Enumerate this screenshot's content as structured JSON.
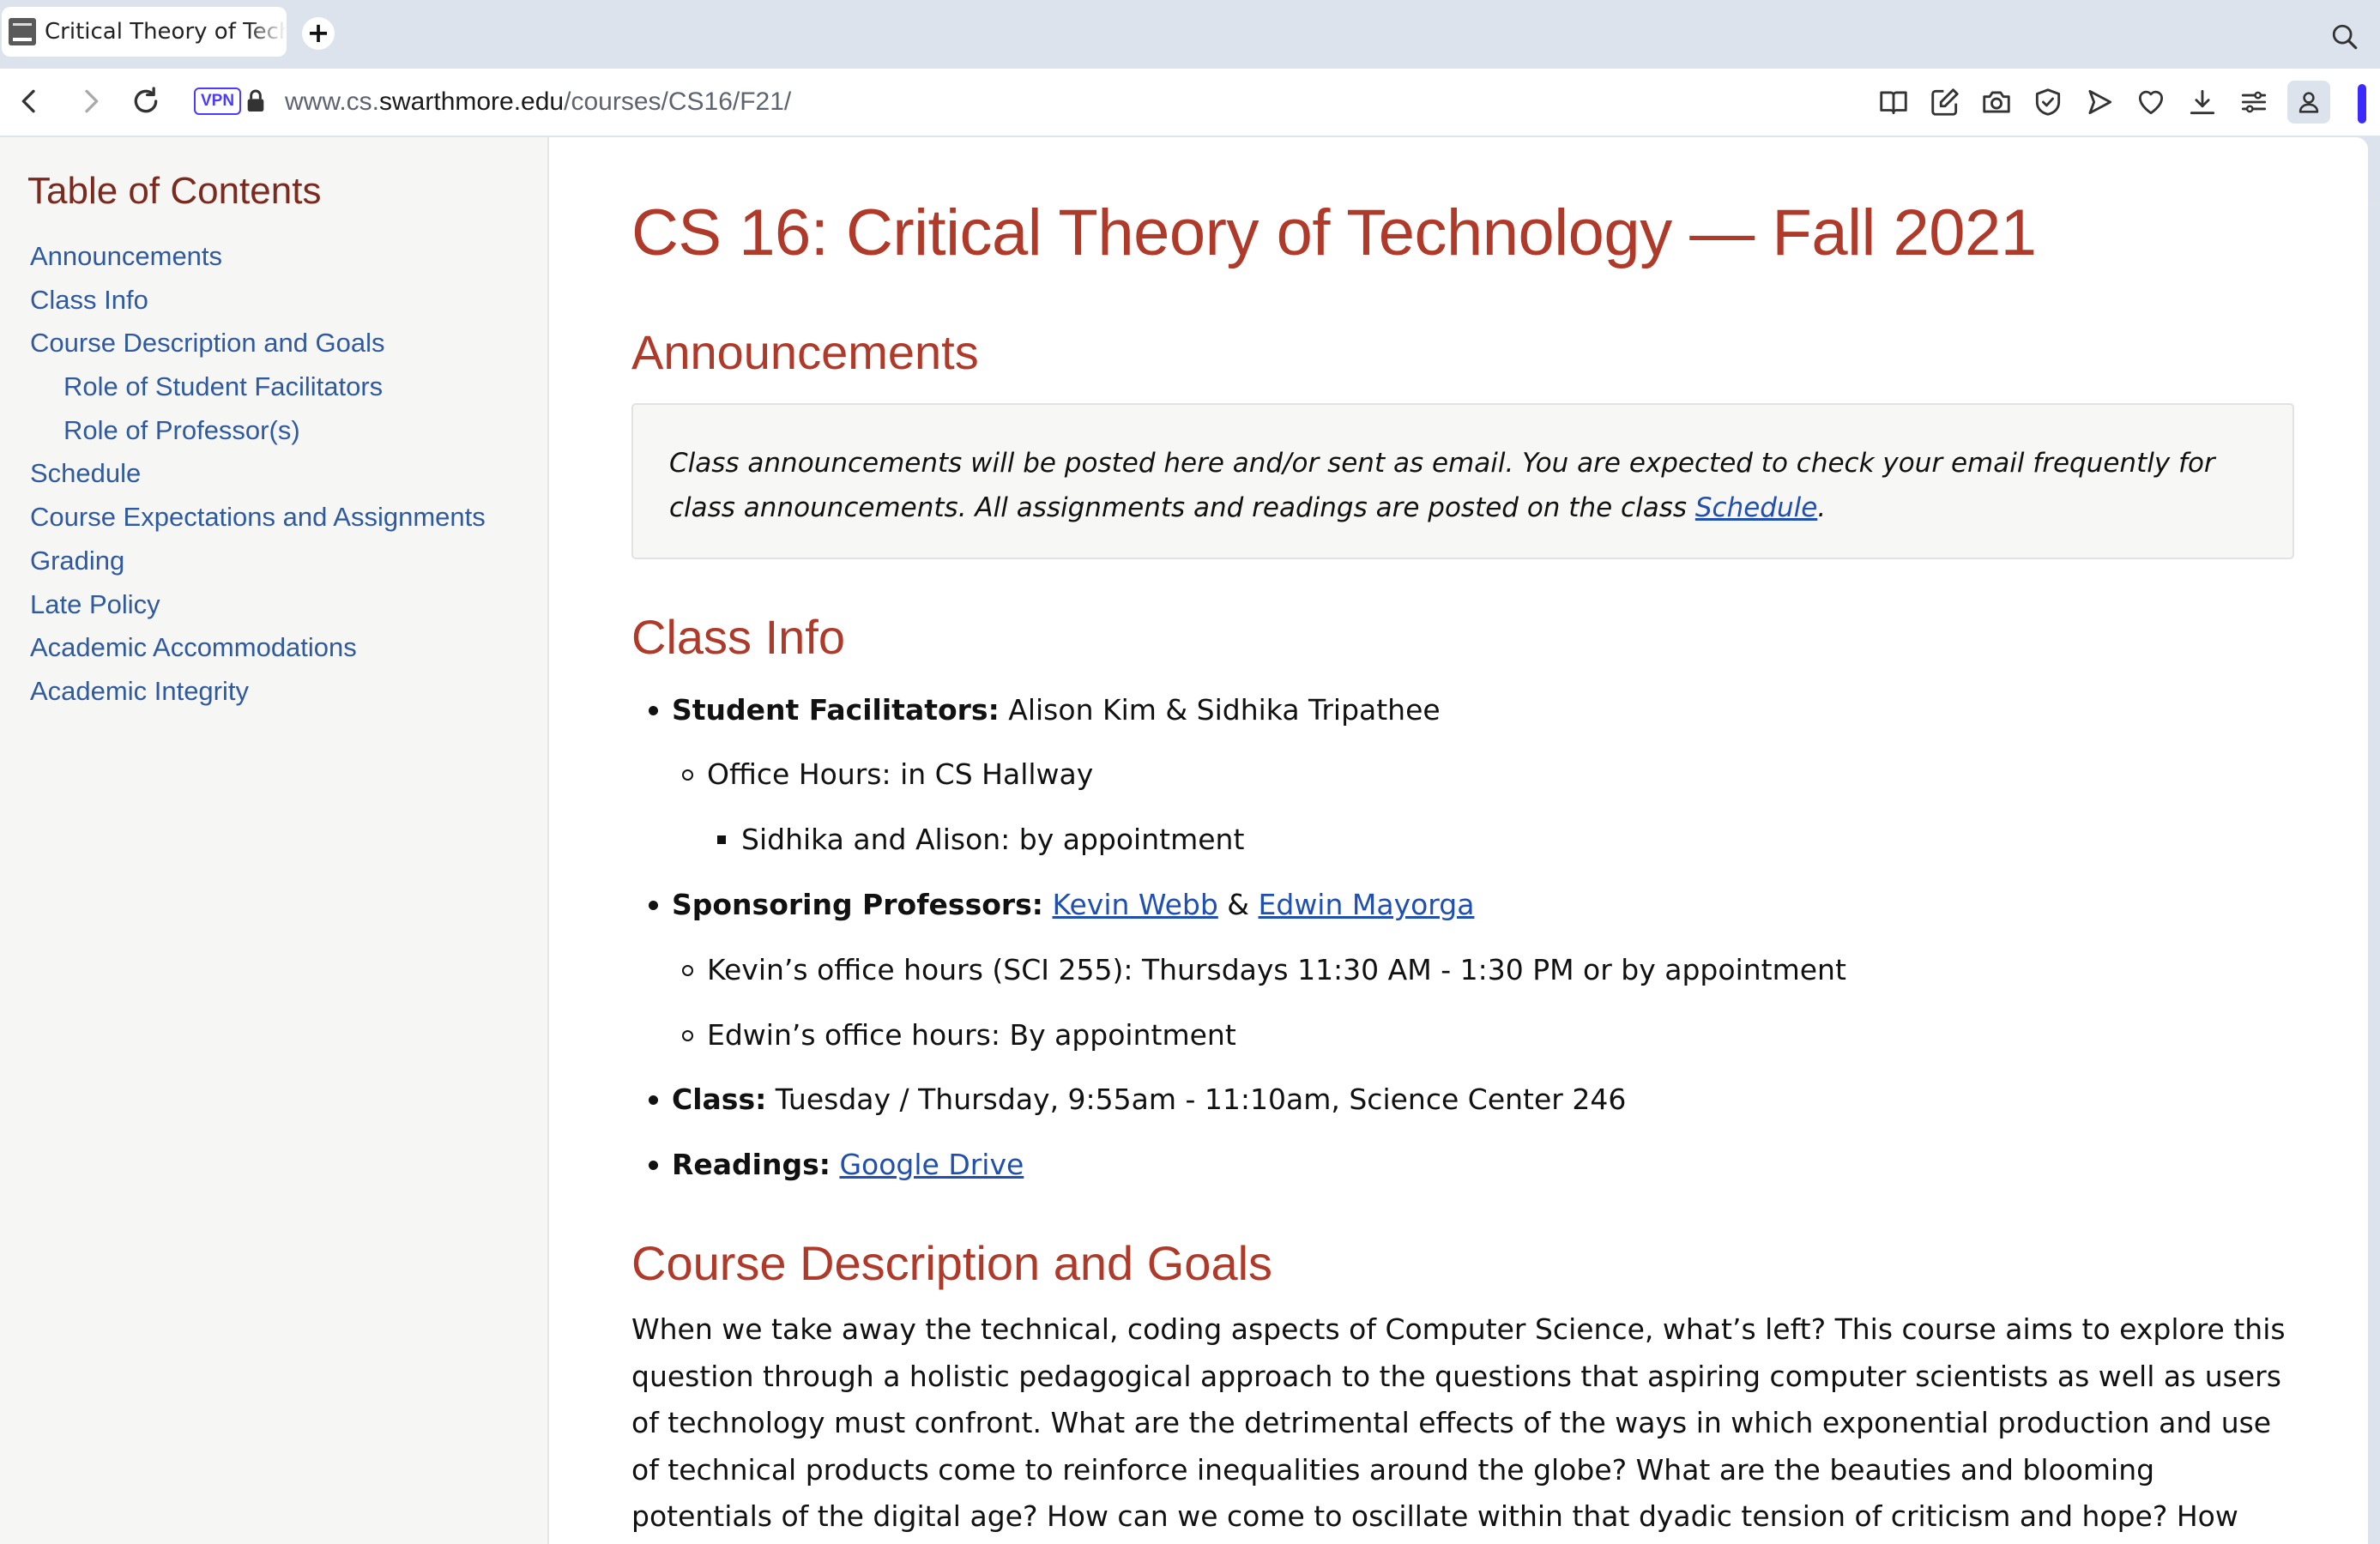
{
  "browser": {
    "tab_title": "Critical Theory of Technology",
    "new_tab_label": "+",
    "vpn_label": "VPN",
    "url_prefix": "www.cs.",
    "url_domain": "swarthmore.edu",
    "url_path": "/courses/CS16/F21/",
    "icons": [
      "back-icon",
      "forward-icon",
      "reload-icon",
      "lock-icon",
      "reader-mode-icon",
      "edit-icon",
      "camera-icon",
      "shield-icon",
      "send-icon",
      "heart-icon",
      "download-icon",
      "settings-icon",
      "profile-icon",
      "search-tabs-icon"
    ],
    "accent_color": "#3b2bff"
  },
  "toc": {
    "title": "Table of Contents",
    "items": [
      {
        "label": "Announcements"
      },
      {
        "label": "Class Info"
      },
      {
        "label": "Course Description and Goals"
      },
      {
        "label": "Role of Student Facilitators"
      },
      {
        "label": "Role of Professor(s)"
      },
      {
        "label": "Schedule"
      },
      {
        "label": "Course Expectations and Assignments"
      },
      {
        "label": "Grading"
      },
      {
        "label": "Late Policy"
      },
      {
        "label": "Academic Accommodations"
      },
      {
        "label": "Academic Integrity"
      }
    ]
  },
  "page": {
    "title": "CS 16: Critical Theory of Technology — Fall 2021",
    "heading_color": "#b03a2a",
    "link_color": "#1f4fb0",
    "announcements": {
      "heading": "Announcements",
      "text_before": "Class announcements will be posted here and/or sent as email. You are expected to check your email frequently for class announcements. All assignments and readings are posted on the class ",
      "link": "Schedule",
      "text_after": "."
    },
    "class_info": {
      "heading": "Class Info",
      "facilitators_label": "Student Facilitators:",
      "facilitators_value": " Alison Kim & Sidhika Tripathee",
      "office_hours": "Office Hours: in CS Hallway",
      "office_hours_detail": "Sidhika and Alison: by appointment",
      "professors_label": "Sponsoring Professors:",
      "professor_1": "Kevin Webb",
      "professor_sep": " & ",
      "professor_2": "Edwin Mayorga",
      "kevin_hours": "Kevin’s office hours (SCI 255): Thursdays 11:30 AM - 1:30 PM or by appointment",
      "edwin_hours": "Edwin’s office hours: By appointment",
      "class_label": "Class:",
      "class_value": " Tuesday / Thursday, 9:55am - 11:10am, Science Center 246",
      "readings_label": "Readings:",
      "readings_link": "Google Drive"
    },
    "description": {
      "heading": "Course Description and Goals",
      "paragraph": "When we take away the technical, coding aspects of Computer Science, what’s left? This course aims to explore this question through a holistic pedagogical approach to the questions that aspiring computer scientists as well as users of technology must confront. What are the detrimental effects of the ways in which exponential production and use of technical products come to reinforce inequalities around the globe? What are the beauties and blooming potentials of the digital age? How can we come to oscillate within that dyadic tension of criticism and hope? How can conversations about tech colonialism,"
    }
  }
}
